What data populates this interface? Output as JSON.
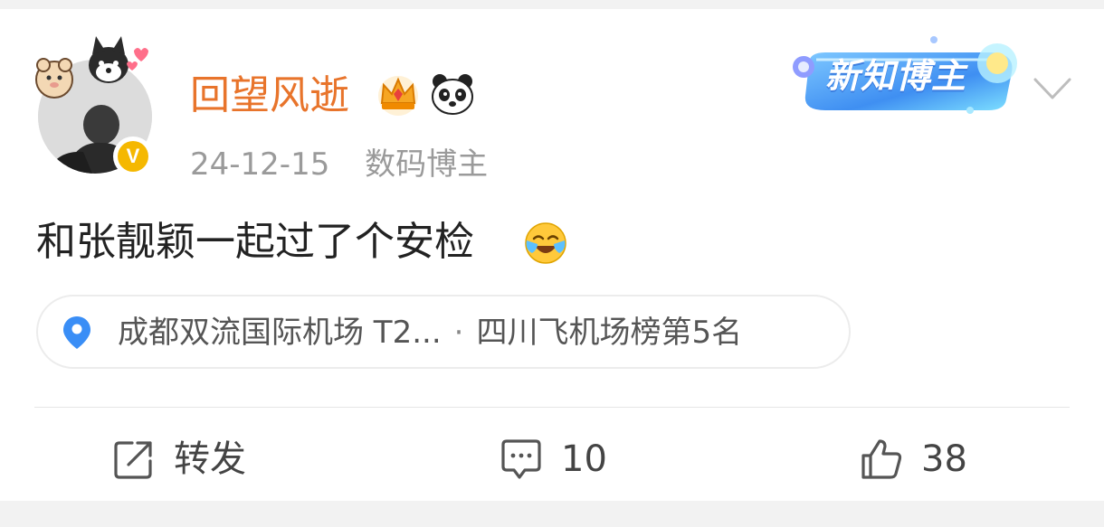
{
  "post": {
    "username": "回望风逝",
    "date": "24-12-15",
    "category": "数码博主",
    "badge_text": "新知博主",
    "verified_mark": "V",
    "body_text": "和张靓颖一起过了个安检",
    "location": {
      "place": "成都双流国际机场 T2...",
      "separator": "·",
      "rank": "四川飞机场榜第5名"
    }
  },
  "actions": {
    "repost_label": "转发",
    "comment_count": "10",
    "like_count": "38"
  },
  "icons": {
    "crown": "crown-icon",
    "panda": "panda-icon",
    "location": "location-pin-icon",
    "repost": "share-icon",
    "comment": "comment-icon",
    "like": "thumbs-up-icon",
    "more": "chevron-down-icon",
    "emoji": "laughing-crying-emoji-icon"
  },
  "colors": {
    "username": "#e8742b",
    "verified": "#f5b800",
    "location_pin": "#3a8ef6",
    "badge_blue": "#4aa3ff"
  }
}
